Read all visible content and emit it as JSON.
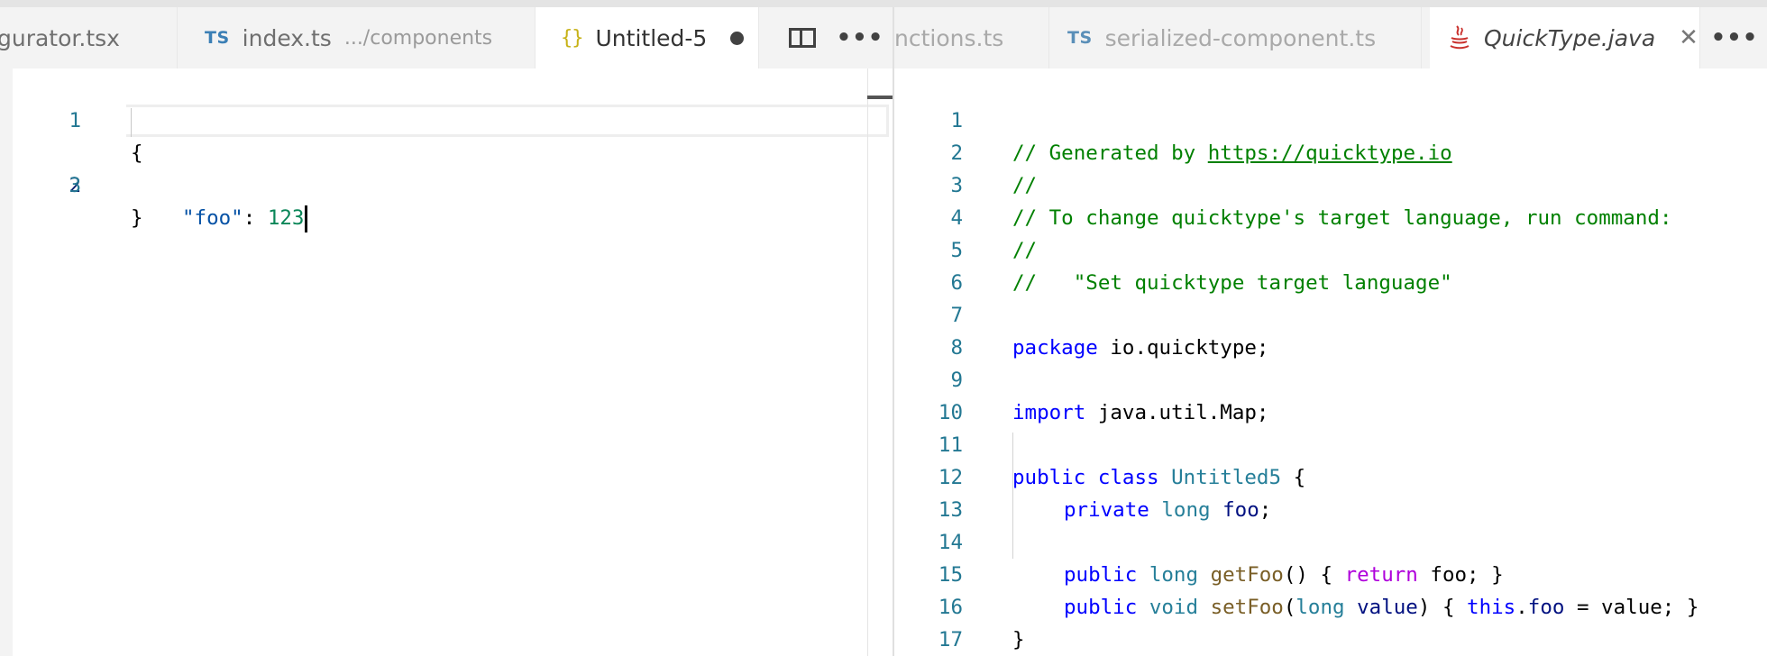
{
  "left_group": {
    "tabs": [
      {
        "label": "gurator.tsx",
        "badge": "",
        "desc": ""
      },
      {
        "label": "index.ts",
        "badge": "TS",
        "desc": ".../components"
      },
      {
        "label": "Untitled-5",
        "icon": "{}",
        "dirty": true,
        "active": true
      }
    ],
    "actions": {
      "more": "•••"
    },
    "lines": [
      {
        "n": "1"
      },
      {
        "n": "2"
      },
      {
        "n": "3"
      }
    ],
    "code": {
      "l1": "{",
      "l2_key": "\"foo\"",
      "l2_colon": ": ",
      "l2_value": "123",
      "l3": "}"
    }
  },
  "right_group": {
    "tabs": [
      {
        "label": "nctions.ts",
        "badge": ""
      },
      {
        "label": "serialized-component.ts",
        "badge": "TS"
      },
      {
        "label": "QuickType.java",
        "icon": "java-icon",
        "active": true,
        "close": "✕"
      }
    ],
    "actions": {
      "more": "•••"
    },
    "line_numbers": [
      "1",
      "2",
      "3",
      "4",
      "5",
      "6",
      "7",
      "8",
      "9",
      "10",
      "11",
      "12",
      "13",
      "14",
      "15",
      "16",
      "17"
    ],
    "code": {
      "l1_comment": "// Generated by ",
      "l1_link": "https://quicktype.io",
      "l2": "//",
      "l3": "// To change quicktype's target language, run command:",
      "l4": "//",
      "l5": "//   \"Set quicktype target language\"",
      "l7_kw": "package",
      "l7_rest": " io.quicktype;",
      "l9_kw": "import",
      "l9_rest": " java.util.Map;",
      "l11_kw1": "public",
      "l11_kw2": "class",
      "l11_type": "Untitled5",
      "l11_brace": " {",
      "l12_kw": "private",
      "l12_type": "long",
      "l12_var": "foo",
      "l12_semi": ";",
      "l14_kw": "public",
      "l14_type": "long",
      "l14_fn": "getFoo",
      "l14_mid": "() { ",
      "l14_ret": "return",
      "l14_end": " foo; }",
      "l15_kw": "public",
      "l15_void": "void",
      "l15_fn": "setFoo",
      "l15_p1": "(",
      "l15_type": "long",
      "l15_param": "value",
      "l15_p2": ") { ",
      "l15_this": "this",
      "l15_dot": ".",
      "l15_field": "foo",
      "l15_end": " = value; }",
      "l16": "}"
    }
  },
  "colors": {
    "comment": "#008000",
    "keyword": "#0000ff",
    "type": "#267f99",
    "function": "#795e26",
    "variable": "#001080",
    "control": "#af00db",
    "line_number": "#237893",
    "ts_badge": "#3b7fb5",
    "json_icon": "#c7b217"
  }
}
